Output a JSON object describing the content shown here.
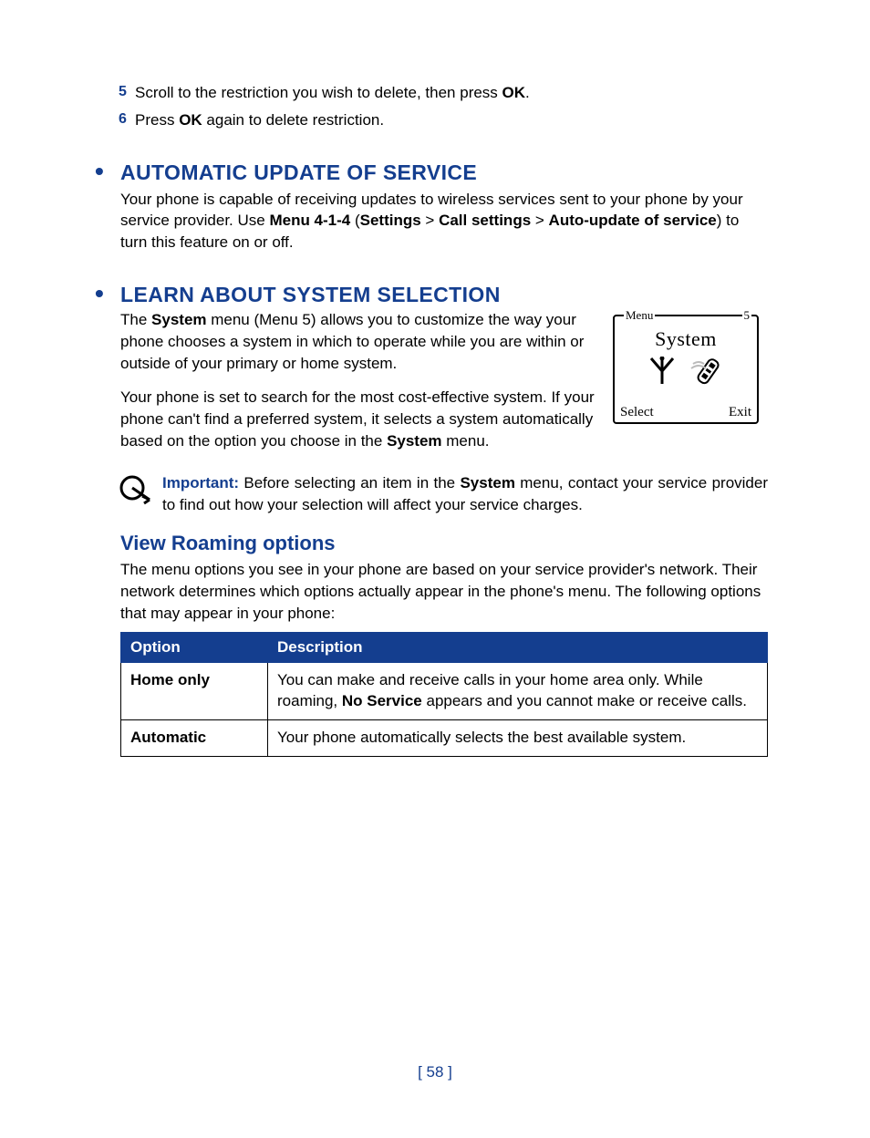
{
  "steps": [
    {
      "num": "5",
      "pre": "Scroll to the restriction you wish to delete, then press ",
      "bold": "OK",
      "post": "."
    },
    {
      "num": "6",
      "pre": "Press ",
      "bold": "OK",
      "post": " again to delete restriction."
    }
  ],
  "section_auto": {
    "heading": "AUTOMATIC UPDATE OF SERVICE",
    "p1a": "Your phone is capable of receiving updates to wireless services sent to your phone by your service provider. Use ",
    "menu": "Menu 4-1-4",
    "paren_open": " (",
    "settings": "Settings",
    "gt1": " > ",
    "call": "Call settings",
    "gt2": " > ",
    "auto": "Auto-update of service",
    "paren_close": ")",
    "p1b": " to turn this feature on or off."
  },
  "section_sys": {
    "heading": "LEARN ABOUT SYSTEM SELECTION",
    "p1a": "The ",
    "p1b": "System",
    "p1c": " menu (Menu 5) allows you to customize the way your phone chooses a system in which to operate while you are within or outside of your primary or home system.",
    "p2a": "Your phone is set to search for the most cost-effective system. If your phone can't find a preferred system, it selects a system automatically based on the option you choose in the ",
    "p2b": "System",
    "p2c": " menu."
  },
  "phone": {
    "menu_label": "Menu",
    "menu_num": "5",
    "title": "System",
    "left": "Select",
    "right": "Exit"
  },
  "important": {
    "label": "Important:",
    "a": " Before selecting an item in the ",
    "b": "System",
    "c": " menu, contact your service provider to find out how your selection will affect your service charges."
  },
  "roaming": {
    "heading": "View Roaming options",
    "intro": "The menu options you see in your phone are based on your service provider's network. Their network determines which options actually appear in the phone's menu. The following options that may appear in your phone:"
  },
  "chart_data": {
    "type": "table",
    "columns": [
      "Option",
      "Description"
    ],
    "rows": [
      {
        "option": "Home only",
        "d1": "You can make and receive calls in your home area only. While roaming, ",
        "d2": "No Service",
        "d3": " appears and you cannot make or receive calls."
      },
      {
        "option": "Automatic",
        "d1": "Your phone automatically selects the best available system.",
        "d2": "",
        "d3": ""
      }
    ]
  },
  "page_number": "[ 58 ]"
}
